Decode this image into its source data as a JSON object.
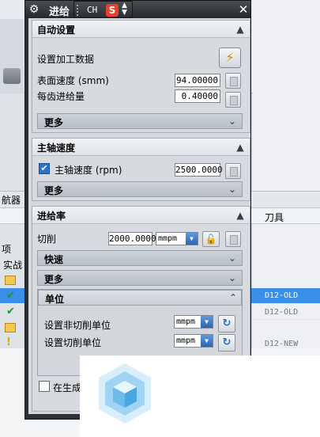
{
  "background": {
    "navigator_title": "航器",
    "tool_column": "刀具",
    "row_labels": [
      "项",
      "实战"
    ],
    "rows": [
      {
        "tool": "D12-OLD",
        "selected": true
      },
      {
        "tool": "D12-OLD",
        "selected": false
      },
      {
        "tool": "D12-NEW",
        "selected": false
      }
    ]
  },
  "dialog": {
    "title": "进给",
    "gear_icon": "gear-icon",
    "close_icon": "close-icon",
    "ime": {
      "label": "CH",
      "logo": "S"
    },
    "auto_settings": {
      "title": "自动设置",
      "set_data_label": "设置加工数据",
      "surface_speed_label": "表面速度 (smm)",
      "surface_speed_value": "94.00000",
      "feed_per_tooth_label": "每齿进给量",
      "feed_per_tooth_value": "0.40000",
      "more_label": "更多"
    },
    "spindle": {
      "title": "主轴速度",
      "spindle_speed_label": "主轴速度 (rpm)",
      "spindle_speed_value": "2500.0000",
      "checked": true,
      "more_label": "更多"
    },
    "feed_rate": {
      "title": "进给率",
      "cut_label": "切削",
      "cut_value": "2000.0000",
      "cut_unit": "mmpm",
      "rapid_label": "快速",
      "more_label": "更多",
      "units": {
        "title": "单位",
        "non_cut_label": "设置非切削单位",
        "non_cut_value": "mmpm",
        "cut_unit_label": "设置切削单位",
        "cut_unit_value": "mmpm"
      },
      "generate_label": "在生成"
    }
  }
}
